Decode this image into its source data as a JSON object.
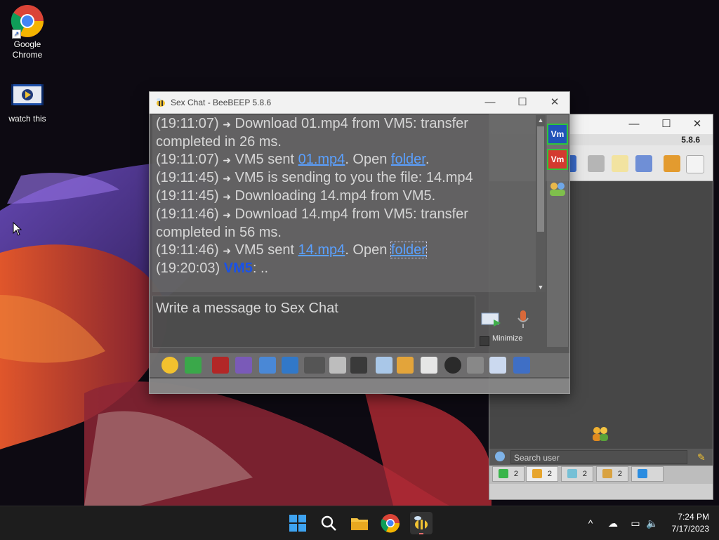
{
  "desktop": {
    "icons": [
      {
        "label": "Google Chrome"
      },
      {
        "label": "watch this"
      }
    ]
  },
  "chat_window": {
    "title": "Sex Chat - BeeBEEP 5.8.6",
    "messages": [
      {
        "time": "(19:11:07)",
        "text": "Download 01.mp4 from VM5: transfer",
        "cont": "completed in 26 ms."
      },
      {
        "time": "(19:11:07)",
        "pre": "VM5 sent ",
        "link": "01.mp4",
        "mid": ". Open ",
        "link2": "folder",
        "post": "."
      },
      {
        "time": "(19:11:45)",
        "text": "VM5 is sending to you the file: 14.mp4"
      },
      {
        "time": "(19:11:45)",
        "text": "Downloading 14.mp4 from VM5."
      },
      {
        "time": "(19:11:46)",
        "text": "Download 14.mp4 from VM5: transfer",
        "cont": "completed in 56 ms."
      },
      {
        "time": "(19:11:46)",
        "pre": "VM5 sent ",
        "link": "14.mp4",
        "mid": ". Open ",
        "link2": "folder"
      },
      {
        "time": "(19:20:03)",
        "nick": "VM5",
        "text": ": .."
      }
    ],
    "compose_placeholder": "Write a message to Sex Chat",
    "minimize_label": "Minimize",
    "side_badges": [
      "Vm",
      "Vm"
    ]
  },
  "main_window": {
    "version": "5.8.6",
    "search_placeholder": "Search user",
    "tabs": [
      {
        "count": "2",
        "icon": "chat-icon"
      },
      {
        "count": "2",
        "icon": "users-icon"
      },
      {
        "count": "2",
        "icon": "bubbles-icon"
      },
      {
        "count": "2",
        "icon": "groups-icon"
      },
      {
        "count": "",
        "icon": "share-icon"
      }
    ]
  },
  "taskbar": {
    "time": "7:24 PM",
    "date": "7/17/2023"
  }
}
